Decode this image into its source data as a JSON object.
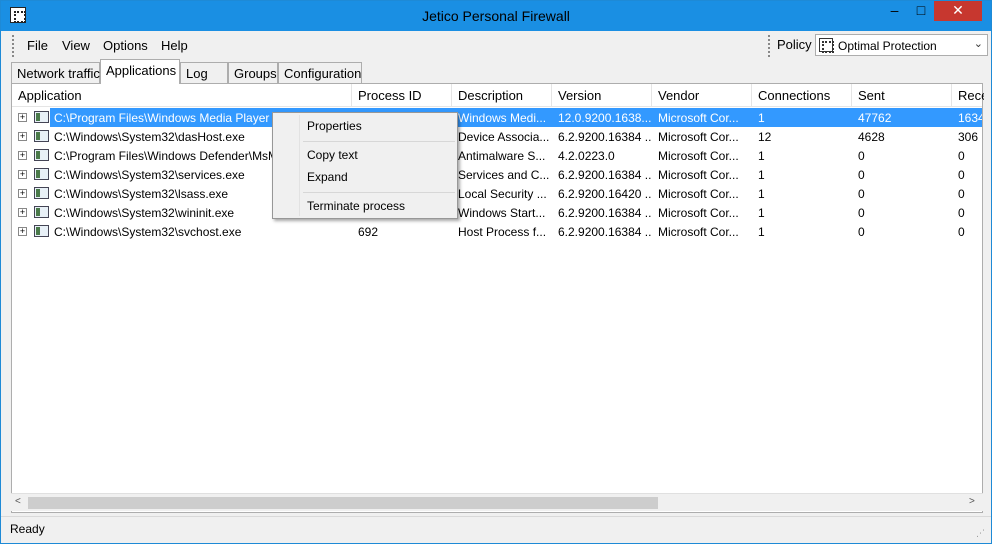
{
  "window": {
    "title": "Jetico Personal Firewall",
    "controls": {
      "minimize": "–",
      "maximize": "□",
      "close": "✕"
    }
  },
  "menu": [
    "File",
    "View",
    "Options",
    "Help"
  ],
  "policy": {
    "label": "Policy",
    "value": "Optimal Protection"
  },
  "tabs": [
    "Network traffic",
    "Applications",
    "Log",
    "Groups",
    "Configuration"
  ],
  "active_tab": "Applications",
  "columns": [
    "Application",
    "Process ID",
    "Description",
    "Version",
    "Vendor",
    "Connections",
    "Sent",
    "Rece"
  ],
  "rows": [
    {
      "app": "C:\\Program Files\\Windows Media Player",
      "pid": "",
      "desc": "Windows Medi...",
      "version": "12.0.9200.1638...",
      "vendor": "Microsoft Cor...",
      "conn": "1",
      "sent": "47762",
      "recv": "1634"
    },
    {
      "app": "C:\\Windows\\System32\\dasHost.exe",
      "pid": "",
      "desc": "Device Associa...",
      "version": "6.2.9200.16384 ...",
      "vendor": "Microsoft Cor...",
      "conn": "12",
      "sent": "4628",
      "recv": "306"
    },
    {
      "app": "C:\\Program Files\\Windows Defender\\MsM",
      "pid": "",
      "desc": "Antimalware S...",
      "version": "4.2.0223.0",
      "vendor": "Microsoft Cor...",
      "conn": "1",
      "sent": "0",
      "recv": "0"
    },
    {
      "app": "C:\\Windows\\System32\\services.exe",
      "pid": "",
      "desc": "Services and C...",
      "version": "6.2.9200.16384 ...",
      "vendor": "Microsoft Cor...",
      "conn": "1",
      "sent": "0",
      "recv": "0"
    },
    {
      "app": "C:\\Windows\\System32\\lsass.exe",
      "pid": "",
      "desc": "Local Security ...",
      "version": "6.2.9200.16420 ...",
      "vendor": "Microsoft Cor...",
      "conn": "1",
      "sent": "0",
      "recv": "0"
    },
    {
      "app": "C:\\Windows\\System32\\wininit.exe",
      "pid": "",
      "desc": "Windows Start...",
      "version": "6.2.9200.16384 ...",
      "vendor": "Microsoft Cor...",
      "conn": "1",
      "sent": "0",
      "recv": "0"
    },
    {
      "app": "C:\\Windows\\System32\\svchost.exe",
      "pid": "692",
      "desc": "Host Process f...",
      "version": "6.2.9200.16384 ...",
      "vendor": "Microsoft Cor...",
      "conn": "1",
      "sent": "0",
      "recv": "0"
    }
  ],
  "context_menu": [
    "Properties",
    "Copy text",
    "Expand",
    "Terminate process"
  ],
  "status": "Ready",
  "colors": {
    "selection": "#3399ff",
    "titlebar": "#1a8fe3",
    "close": "#c7372f"
  }
}
